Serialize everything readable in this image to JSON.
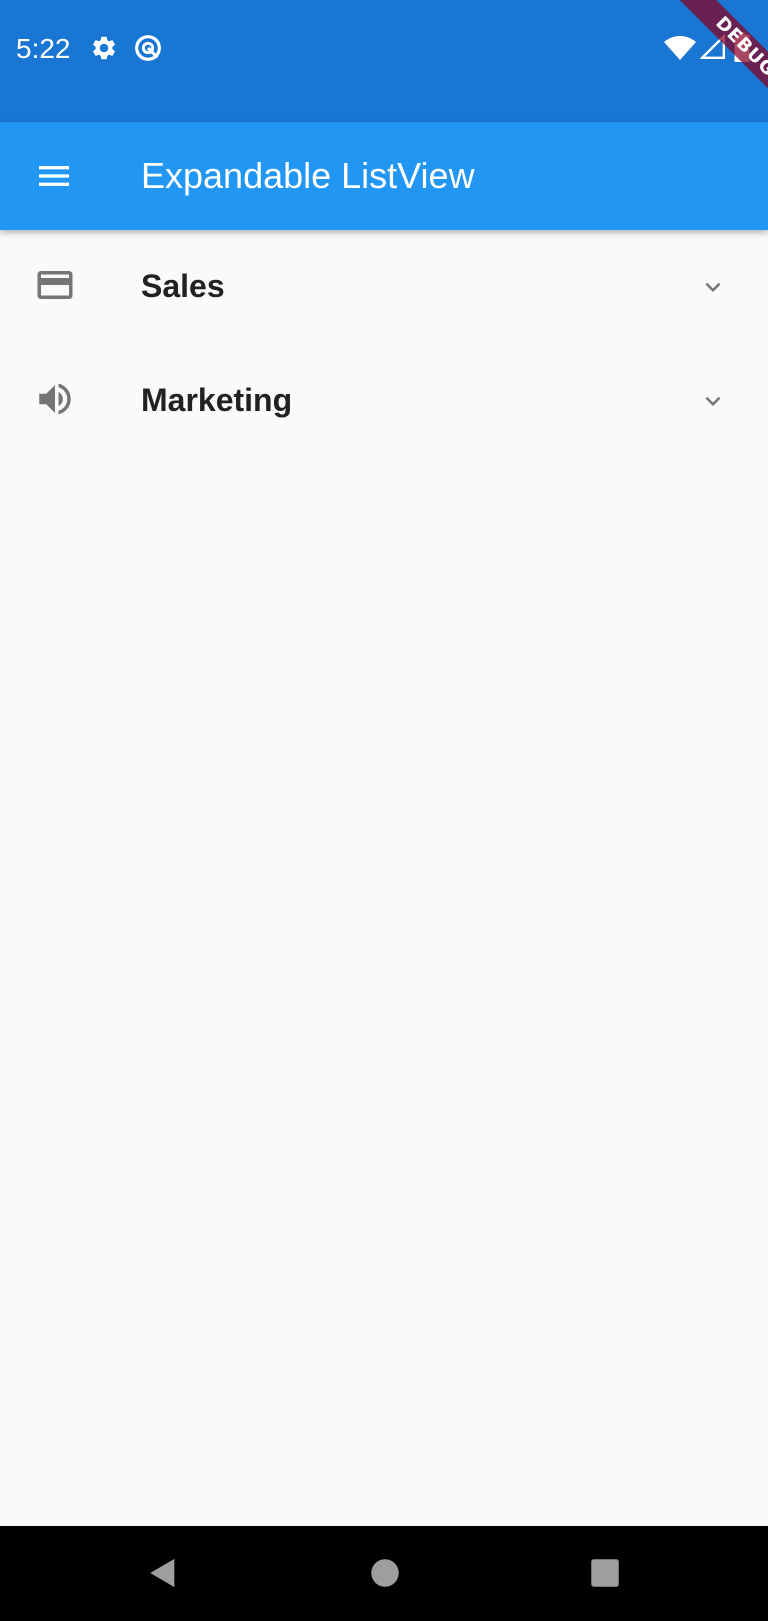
{
  "status_bar": {
    "time": "5:22",
    "background": "#1976d2"
  },
  "debug_banner": {
    "label": "DEBUG"
  },
  "app_bar": {
    "title": "Expandable ListView",
    "background": "#2196f3",
    "menu_icon": "menu-icon"
  },
  "list": {
    "items": [
      {
        "label": "Sales",
        "leading_icon": "credit-card-icon",
        "trailing_icon": "chevron-down-icon",
        "expanded": false
      },
      {
        "label": "Marketing",
        "leading_icon": "volume-up-icon",
        "trailing_icon": "chevron-down-icon",
        "expanded": false
      }
    ]
  },
  "nav_bar": {
    "buttons": [
      "back",
      "home",
      "recents"
    ]
  }
}
